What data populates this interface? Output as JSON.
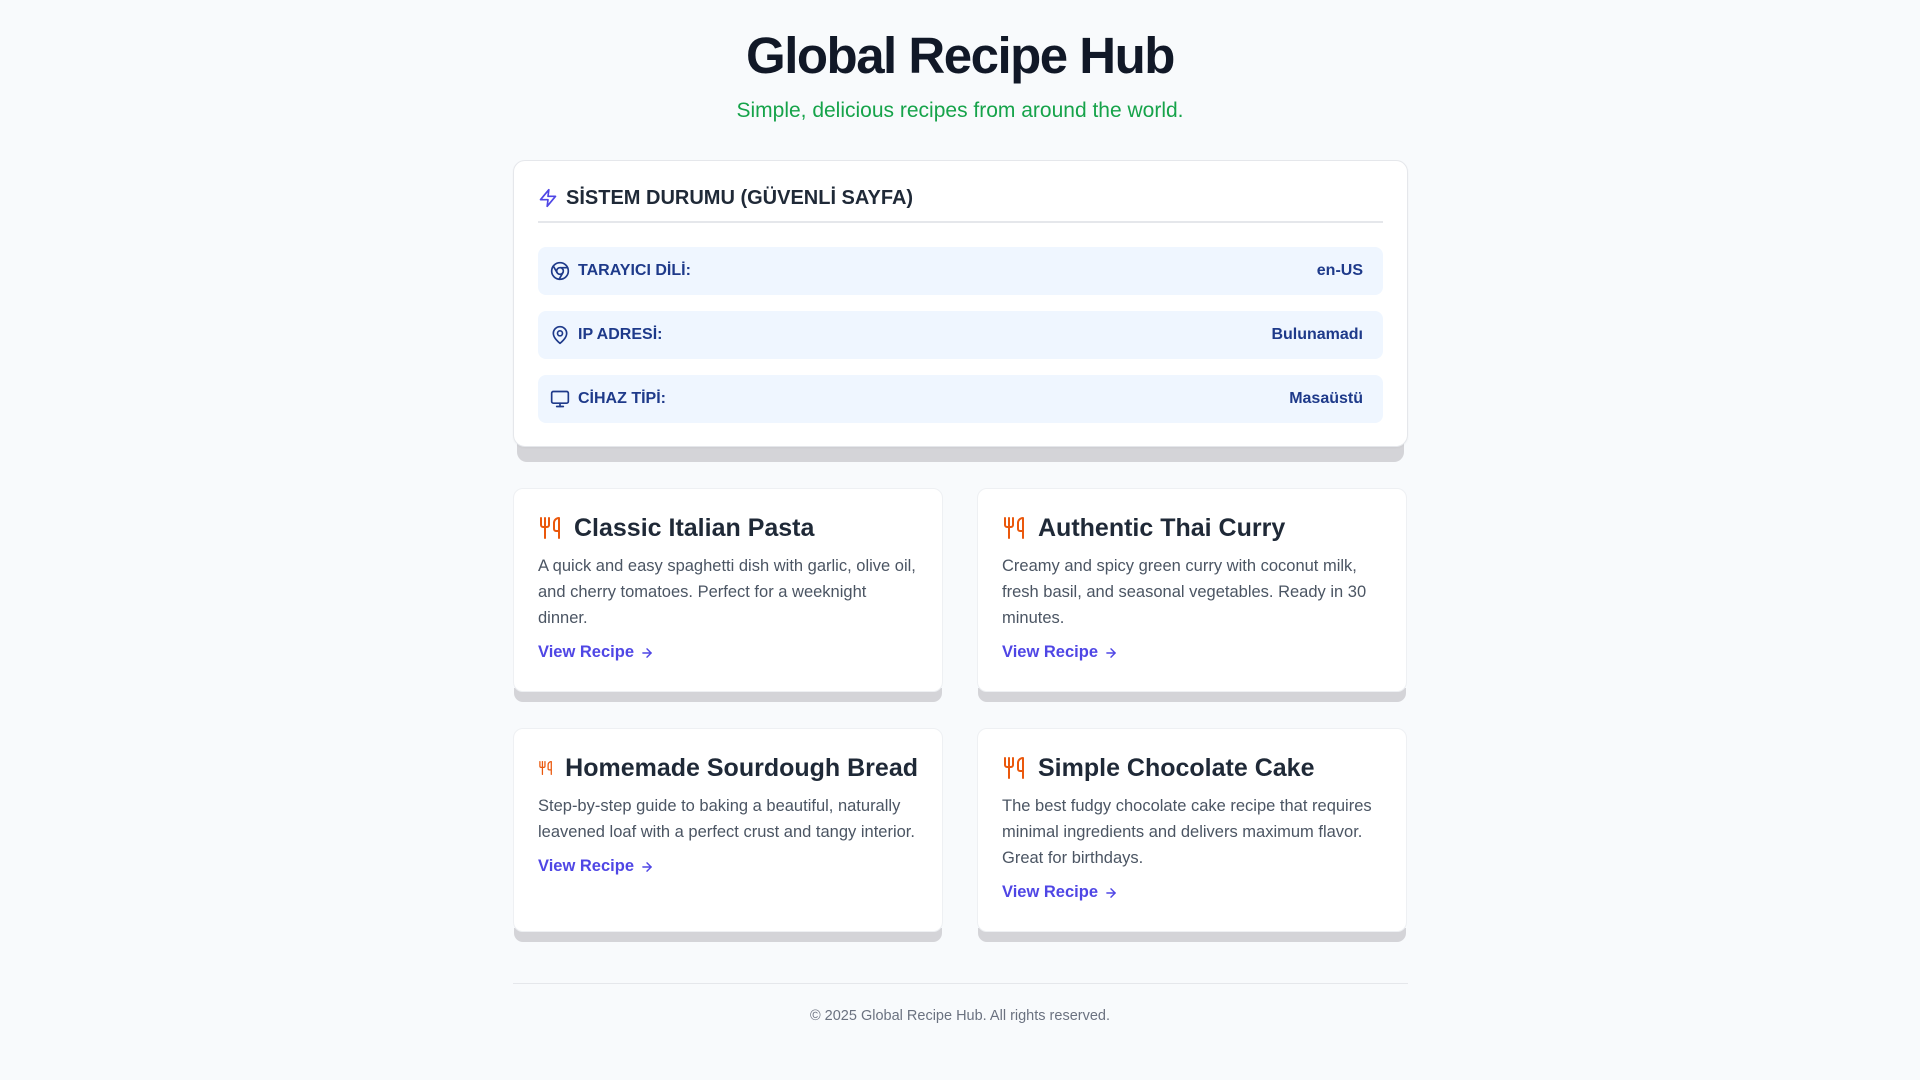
{
  "header": {
    "title": "Global Recipe Hub",
    "subtitle": "Simple, delicious recipes from around the world."
  },
  "status": {
    "title": "SİSTEM DURUMU (GÜVENLİ SAYFA)",
    "rows": [
      {
        "label": "TARAYICI DİLİ:",
        "value": "en-US",
        "icon": "chrome-icon"
      },
      {
        "label": "IP ADRESİ:",
        "value": "Bulunamadı",
        "icon": "map-pin-icon"
      },
      {
        "label": "CİHAZ TİPİ:",
        "value": "Masaüstü",
        "icon": "monitor-icon"
      }
    ]
  },
  "recipes": [
    {
      "title": "Classic Italian Pasta",
      "description": "A quick and easy spaghetti dish with garlic, olive oil, and cherry tomatoes. Perfect for a weeknight dinner.",
      "link": "View Recipe"
    },
    {
      "title": "Authentic Thai Curry",
      "description": "Creamy and spicy green curry with coconut milk, fresh basil, and seasonal vegetables. Ready in 30 minutes.",
      "link": "View Recipe"
    },
    {
      "title": "Homemade Sourdough Bread",
      "description": "Step-by-step guide to baking a beautiful, naturally leavened loaf with a perfect crust and tangy interior.",
      "link": "View Recipe"
    },
    {
      "title": "Simple Chocolate Cake",
      "description": "The best fudgy chocolate cake recipe that requires minimal ingredients and delivers maximum flavor. Great for birthdays.",
      "link": "View Recipe"
    }
  ],
  "footer": {
    "text": "© 2025 Global Recipe Hub. All rights reserved."
  },
  "colors": {
    "accent": "#4f46e5",
    "subtitle": "#16a34a",
    "utensils_icon": "#ea580c",
    "status_row_bg": "#eff6ff",
    "status_text": "#1e3a8a"
  }
}
